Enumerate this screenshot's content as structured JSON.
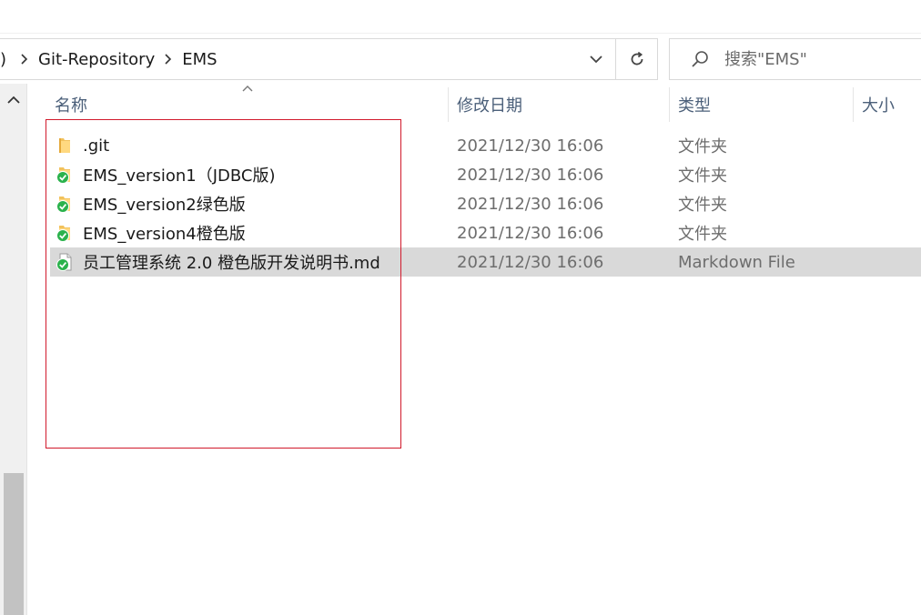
{
  "breadcrumb": {
    "partial": ")",
    "items": [
      "Git-Repository",
      "EMS"
    ]
  },
  "search": {
    "placeholder": "搜索\"EMS\""
  },
  "columns": {
    "name": "名称",
    "date": "修改日期",
    "type": "类型",
    "size": "大小"
  },
  "files": [
    {
      "name": ".git",
      "date": "2021/12/30 16:06",
      "type": "文件夹",
      "icon": "folder-icon",
      "synced": false
    },
    {
      "name": "EMS_version1（JDBC版)",
      "date": "2021/12/30 16:06",
      "type": "文件夹",
      "icon": "folder-synced-icon",
      "synced": true
    },
    {
      "name": "EMS_version2绿色版",
      "date": "2021/12/30 16:06",
      "type": "文件夹",
      "icon": "folder-synced-icon",
      "synced": true
    },
    {
      "name": "EMS_version4橙色版",
      "date": "2021/12/30 16:06",
      "type": "文件夹",
      "icon": "folder-synced-icon",
      "synced": true
    },
    {
      "name": "员工管理系统 2.0 橙色版开发说明书.md",
      "date": "2021/12/30 16:06",
      "type": "Markdown File",
      "icon": "file-synced-icon",
      "synced": true,
      "selected": true
    }
  ],
  "colors": {
    "folder": "#f2c25c",
    "sync_badge": "#2bb24c",
    "annotation": "#d1192b",
    "selected_row": "#d9d9d9",
    "header_text": "#4c607a"
  }
}
